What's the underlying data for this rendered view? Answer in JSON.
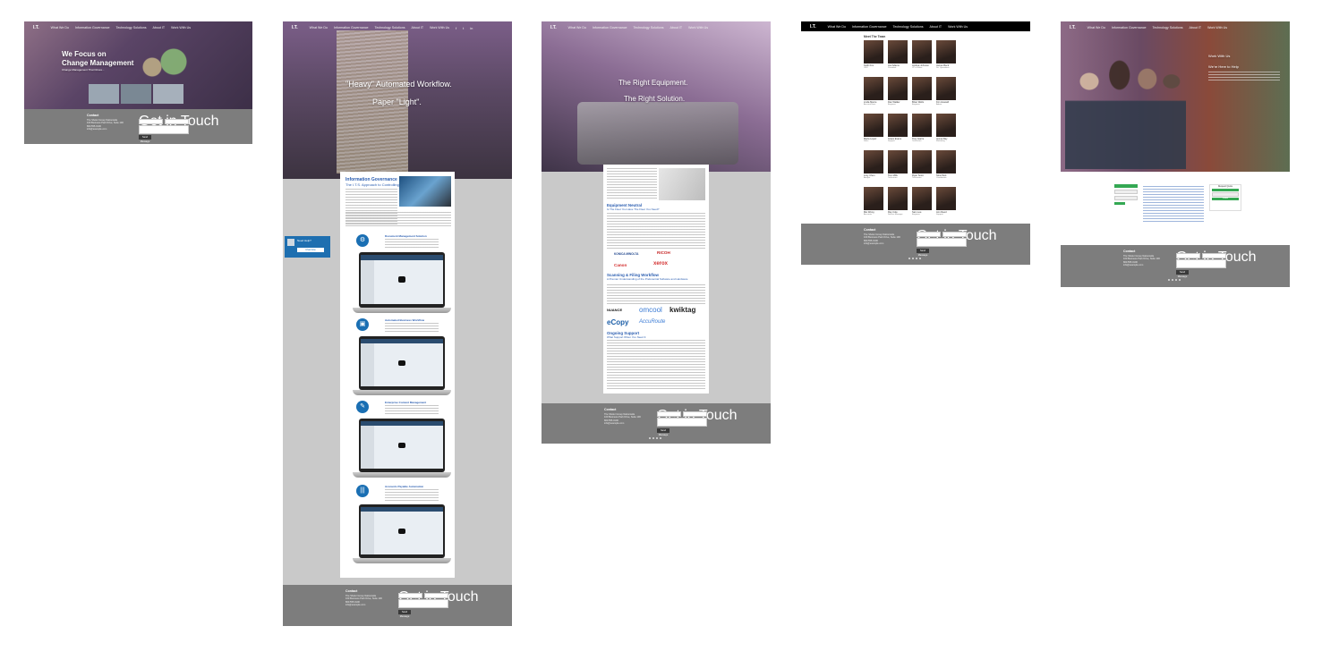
{
  "brand": {
    "logo_text": "I.T."
  },
  "nav": {
    "links": [
      "What We Do",
      "Information Governance",
      "Technology Solutions",
      "About IT",
      "Work With Us"
    ]
  },
  "social": [
    "f",
    "t",
    "in"
  ],
  "page1": {
    "hero_title_line1": "We Focus on",
    "hero_title_line2": "Change Management",
    "hero_sub": "Change Management That Drives..."
  },
  "page2": {
    "hero_line1": "\"Heavy\" Automated Workflow.",
    "hero_line2": "Paper \"Light\".",
    "section_title": "Information Governance",
    "section_sub": "The I.T.S. Approach to Controlling",
    "features": [
      {
        "title": "Document Management Solution",
        "icon": "gear"
      },
      {
        "title": "Automated Business Workflow",
        "icon": "briefcase"
      },
      {
        "title": "Enterprise Content Management",
        "icon": "pencil"
      },
      {
        "title": "Accounts Payable Automation",
        "icon": "barcode"
      }
    ],
    "chat": {
      "title": "Need Help?",
      "button": "Chat Now"
    }
  },
  "page3": {
    "hero_line1": "The Right Equipment.",
    "hero_line2": "The Right Solution.",
    "equip_title": "Equipment Neutral",
    "equip_sub": "Is The Fleet You Have The Fleet You Need?",
    "scan_title": "Scanning & Filing Workflow",
    "scan_sub": "A Premier Understanding of the Preferential Software and Hardware",
    "support_title": "Ongoing Support",
    "support_sub": "What Support When You Need It",
    "hardware_logos": [
      "KONICA MINOLTA",
      "RICOH",
      "Canon",
      "xerox"
    ],
    "software_logos": [
      "NUANCE",
      "omcool",
      "kwiktag",
      "eCopy",
      "AccuRoute"
    ]
  },
  "page4": {
    "team_title": "Meet The Team",
    "members": [
      {
        "name": "Keith Kim",
        "role": "CEO"
      },
      {
        "name": "Joe Adams",
        "role": "President"
      },
      {
        "name": "Andrea Johnson",
        "role": "VP of Sales"
      },
      {
        "name": "James Beck",
        "role": "Dir. Operations"
      },
      {
        "name": "Linda Moore",
        "role": "Account Exec"
      },
      {
        "name": "Dan Walker",
        "role": "Engineer"
      },
      {
        "name": "Brian Wells",
        "role": "Engineer"
      },
      {
        "name": "Kim Howard",
        "role": "Admin"
      },
      {
        "name": "Maria Lopez",
        "role": "Sales"
      },
      {
        "name": "Grace Evans",
        "role": "Support"
      },
      {
        "name": "Tony Harris",
        "role": "Technician"
      },
      {
        "name": "Jenna Ray",
        "role": "Marketing"
      },
      {
        "name": "Lucy Chen",
        "role": "Analyst"
      },
      {
        "name": "Tom Mills",
        "role": "Technician"
      },
      {
        "name": "Ryan Scott",
        "role": "Technician"
      },
      {
        "name": "Nina Park",
        "role": "Coordinator"
      },
      {
        "name": "Mei Wong",
        "role": "Accounts"
      },
      {
        "name": "Ray Cole",
        "role": "Service Manager"
      },
      {
        "name": "Sam Lee",
        "role": "Engineer"
      },
      {
        "name": "Ann Reed",
        "role": "Support"
      }
    ]
  },
  "page5": {
    "hero_line1": "Work With Us",
    "hero_line2": "We're Here to Help",
    "form_title": "Request Quote",
    "form_button": "Submit"
  },
  "footer": {
    "contact_title": "Contact",
    "company": "The Sholer Group Nationwide",
    "address": "100 Business Park Drive, Suite 100",
    "phone": "800.555.0100",
    "email": "info@example.com",
    "form_title": "Get in Touch",
    "send_label": "Send Message"
  },
  "colors": {
    "hero_overlay": "#6b4d7a",
    "footer_bg": "#7d7d7d",
    "accent_blue": "#1a6fb3",
    "content_bg": "#c9c9c9"
  }
}
